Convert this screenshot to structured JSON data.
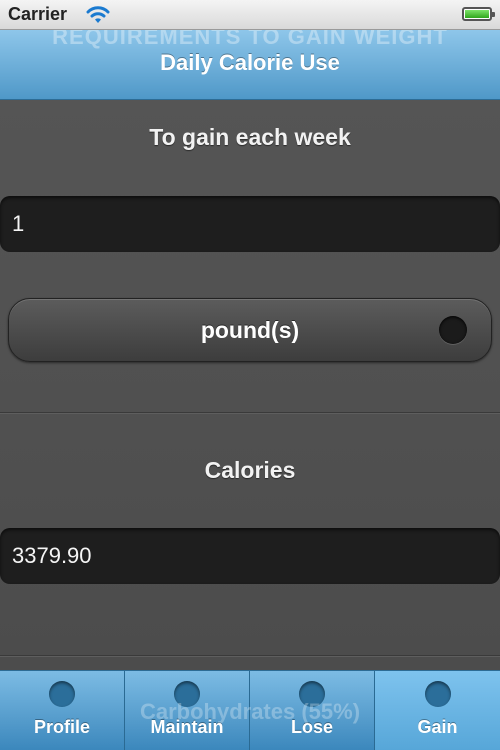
{
  "status_bar": {
    "carrier": "Carrier"
  },
  "header": {
    "ghost_title": "REQUIREMENTS TO GAIN WEIGHT",
    "title": "Daily Calorie Use"
  },
  "form": {
    "gain_label": "To gain each week",
    "gain_value": "1",
    "unit_label": "pound(s)",
    "calories_label": "Calories",
    "calories_value": "3379.90"
  },
  "ghost_bottom_text": "Carbohydrates (55%)",
  "tab_bar": {
    "tabs": [
      {
        "label": "Profile"
      },
      {
        "label": "Maintain"
      },
      {
        "label": "Lose"
      },
      {
        "label": "Gain",
        "active": true
      }
    ]
  },
  "colors": {
    "header": "#6aaedc",
    "background": "#4f4f4f",
    "field": "#1e1e1e"
  }
}
